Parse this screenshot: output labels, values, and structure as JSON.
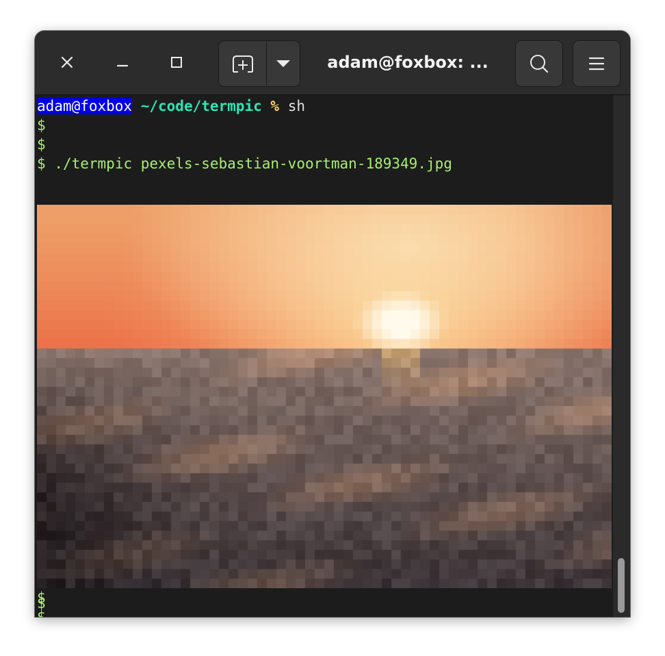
{
  "window": {
    "title": "adam@foxbox: ..."
  },
  "titlebar": {
    "close_icon": "close-icon",
    "minimize_icon": "minimize-icon",
    "maximize_icon": "maximize-icon",
    "new_tab_icon": "new-tab-icon",
    "tab_menu_icon": "chevron-down-icon",
    "search_icon": "search-icon",
    "menu_icon": "hamburger-menu-icon"
  },
  "terminal": {
    "prompt_user": "adam@foxbox",
    "prompt_path": "~/code/termpic",
    "prompt_symbol": "%",
    "prompt_command": "sh",
    "shell_prompt": "$",
    "run_command": "./termpic pexels-sebastian-voortman-189349.jpg",
    "image_description": "pixelated sunset over ocean"
  },
  "colors": {
    "user_bg": "#0000e6",
    "path": "#2be6b4",
    "percent": "#ffd86a",
    "shell_text": "#a8f070"
  }
}
